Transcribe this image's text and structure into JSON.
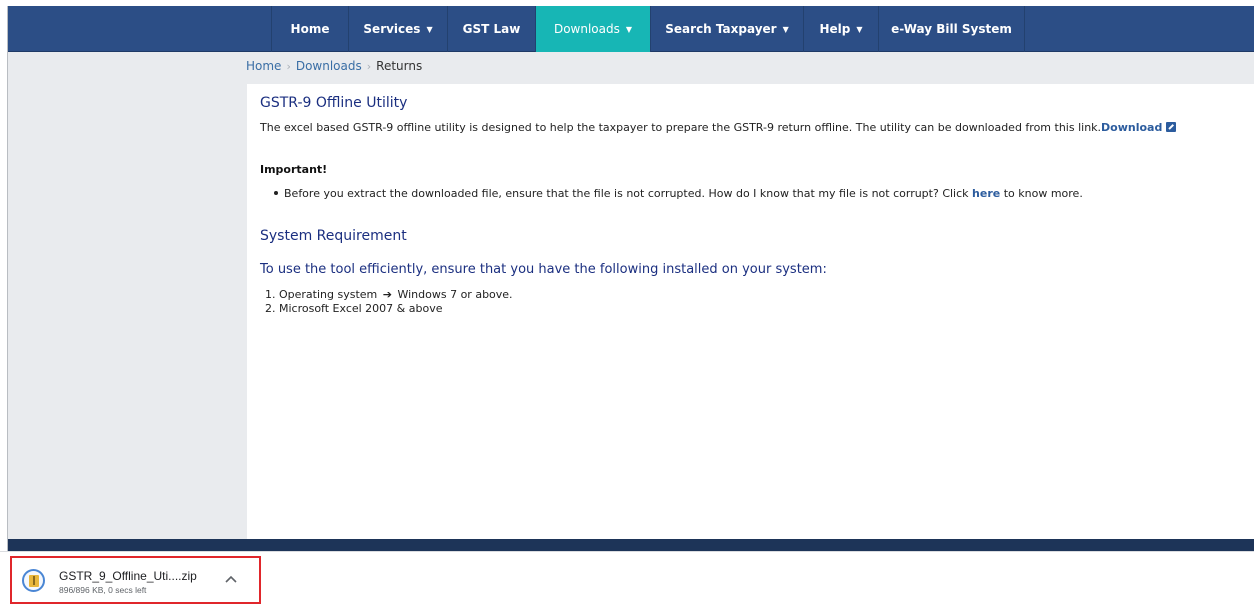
{
  "nav": {
    "items": [
      {
        "label": "Home",
        "caret": false
      },
      {
        "label": "Services",
        "caret": true
      },
      {
        "label": "GST Law",
        "caret": false
      },
      {
        "label": "Downloads",
        "caret": true,
        "active": true
      },
      {
        "label": "Search Taxpayer",
        "caret": true
      },
      {
        "label": "Help",
        "caret": true
      },
      {
        "label": "e-Way Bill System",
        "caret": false
      }
    ]
  },
  "breadcrumb": {
    "home": "Home",
    "downloads": "Downloads",
    "current": "Returns"
  },
  "content": {
    "title": "GSTR-9 Offline Utility",
    "intro": "The excel based GSTR-9 offline utility is designed to help the taxpayer to prepare the GSTR-9 return offline. The utility can be downloaded from this link.",
    "download_link": "Download",
    "important_label": "Important!",
    "bullet_text": "Before you extract the downloaded file, ensure that the file is not corrupted. How do I know that my file is not corrupt? Click",
    "bullet_link": "here",
    "bullet_tail": "to know more.",
    "sys_title": "System Requirement",
    "use_title": "To use the tool efficiently, ensure that you have the following installed on your system:",
    "req1_prefix": "1. Operating system",
    "req1_suffix": "Windows 7 or above.",
    "req2": "2. Microsoft Excel 2007 & above"
  },
  "download_shelf": {
    "file_name": "GSTR_9_Offline_Uti....zip",
    "status": "896/896 KB, 0 secs left"
  },
  "colors": {
    "navbar": "#2c4e86",
    "active_tab": "#17b6b5",
    "heading": "#1b2f80",
    "link": "#2c5c9e",
    "highlight_box": "#e0262b"
  }
}
